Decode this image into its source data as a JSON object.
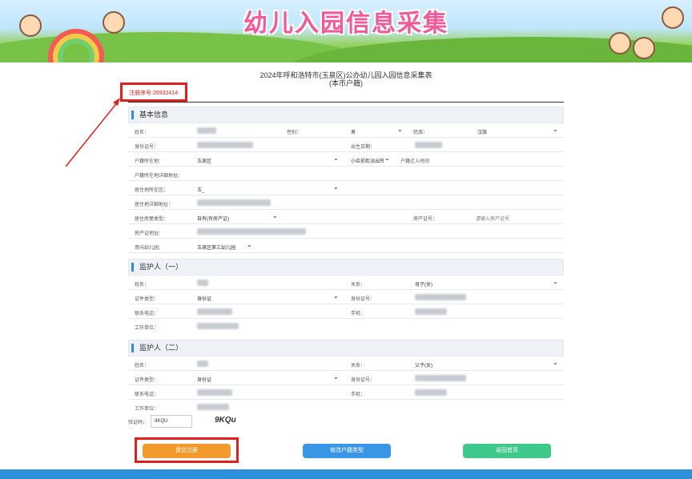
{
  "banner": {
    "title": "幼儿入园信息采集"
  },
  "form": {
    "title": "2024年呼和浩特市(玉泉区)公办幼儿园入园信息采集表",
    "subtitle": "(本市户籍)",
    "registration": "注册序号:26932414"
  },
  "basic": {
    "title": "基本信息",
    "name_label": "姓名：",
    "gender_label": "性别：",
    "gender_value": "男",
    "ethnic_label": "民族：",
    "ethnic_value": "汉族",
    "id_label": "身份证号：",
    "birth_label": "出生日期：",
    "hukou_loc_label": "户籍所在地：",
    "hukou_loc_value": "玉泉区",
    "police_label": "小召前街派出所",
    "hukou_time_label": "户籍迁入时间",
    "hukou_addr_label": "户籍所在地详细地址：",
    "res_district_label": "居住地所在区：",
    "res_district_value": "玉_",
    "res_addr_label": "居住地详细地址：",
    "housing_type_label": "居住房屋类型：",
    "housing_type_value": "自有(有房产证)",
    "cert_label": "房产证号：",
    "cert_placeholder": "请输入房产证号",
    "cert_addr_label": "房产证地址：",
    "kindergarten_label": "意向幼儿园：",
    "kindergarten_value": "玉泉区第三幼儿园"
  },
  "guardian1": {
    "title": "监护人（一）",
    "name_label": "姓名：",
    "relation_label": "关系：",
    "relation_value": "母子(女)",
    "id_type_label": "证件类型：",
    "id_type_value": "身份证",
    "id_label": "身份证号：",
    "phone_label": "联系电话：",
    "mobile_label": "手机：",
    "work_label": "工作单位："
  },
  "guardian2": {
    "title": "监护人（二）",
    "name_label": "姓名：",
    "relation_label": "关系：",
    "relation_value": "父子(女)",
    "id_type_label": "证件类型：",
    "id_type_value": "身份证",
    "id_label": "身份证号：",
    "phone_label": "联系电话：",
    "mobile_label": "手机：",
    "work_label": "工作单位："
  },
  "captcha": {
    "label": "验证码：",
    "input_value": "9KQU",
    "code": "9KQu"
  },
  "buttons": {
    "submit": "提交注册",
    "change_hukou": "修改户籍类型",
    "home": "返回首页"
  },
  "colors": {
    "submit": "#f39a2c",
    "change_hukou": "#3a97e8",
    "home": "#3ec98b",
    "accent": "#2e8fd8",
    "annotation": "#e02020"
  }
}
